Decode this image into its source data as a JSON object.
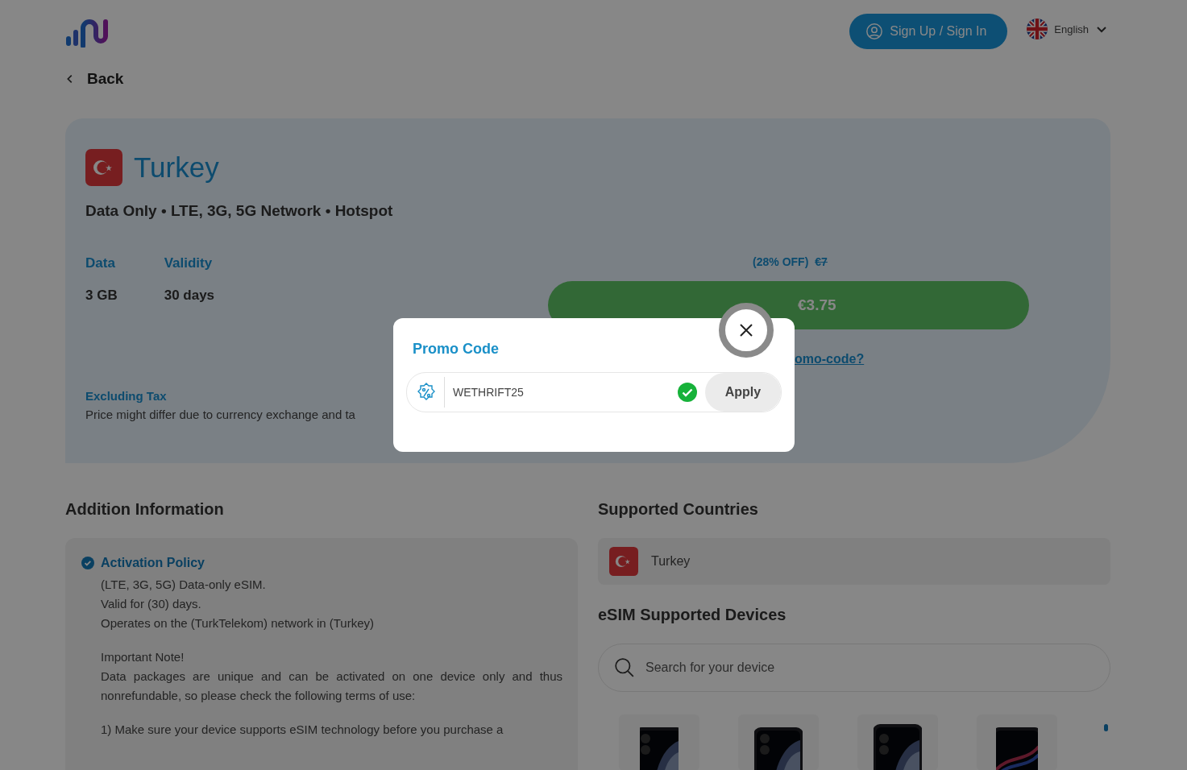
{
  "header": {
    "sign_in_button": "Sign Up / Sign In",
    "language": "English"
  },
  "back_link": "Back",
  "plan": {
    "country": "Turkey",
    "features": "Data Only • LTE, 3G, 5G Network • Hotspot",
    "specs": [
      {
        "label": "Data",
        "value": "3 GB"
      },
      {
        "label": "Validity",
        "value": "30 days"
      }
    ],
    "discount": "(28% OFF)",
    "old_price": "€7",
    "buy_button": "€3.75",
    "promo_link": "omo-code?",
    "tax_title": "Excluding Tax",
    "tax_note": "Price might differ due to currency exchange and ta"
  },
  "additional_info": {
    "heading": "Addition Information",
    "policy": {
      "title": "Activation Policy",
      "paragraphs": [
        {
          "lines": [
            "(LTE, 3G, 5G) Data-only eSIM.",
            "Valid for (30) days.",
            "Operates on the (TurkTelekom) network in (Turkey)"
          ]
        },
        {
          "lines": [
            "Important Note!",
            "Data packages are unique and can be activated on one device only and thus nonrefundable, so please check the following terms of use:"
          ]
        },
        {
          "lines": [
            "1) Make sure your device supports eSIM technology before you purchase a"
          ]
        }
      ]
    }
  },
  "supported_countries": {
    "heading": "Supported Countries",
    "countries": [
      {
        "name": "Turkey"
      }
    ]
  },
  "devices": {
    "heading": "eSIM Supported Devices",
    "search_placeholder": "Search for your device"
  },
  "promo_modal": {
    "title": "Promo Code",
    "code": "WETHRIFT25",
    "valid": true,
    "apply_button": "Apply"
  }
}
